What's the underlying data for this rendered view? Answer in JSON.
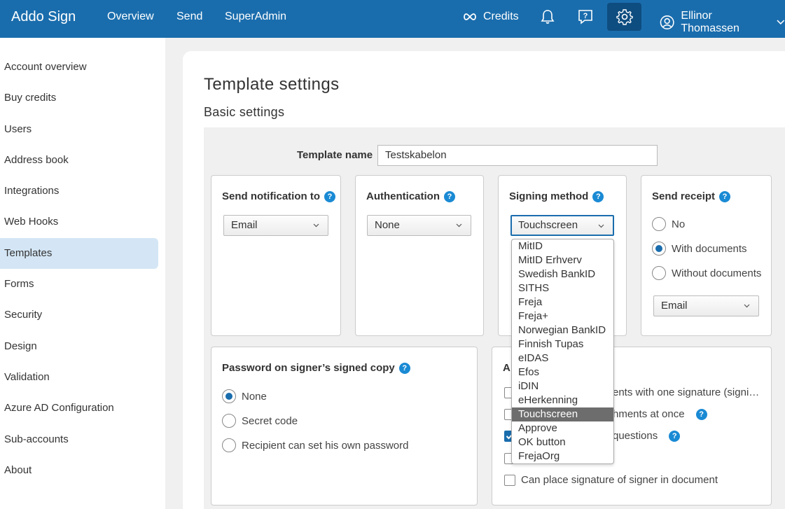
{
  "topbar": {
    "logo": "Addo Sign",
    "nav": [
      "Overview",
      "Send",
      "SuperAdmin"
    ],
    "credits": "Credits",
    "user": "Ellinor Thomassen",
    "icons": [
      "infinity-icon",
      "bell-icon",
      "help-chat-icon",
      "gear-icon",
      "user-icon",
      "chevron-down-icon"
    ]
  },
  "sidebar": {
    "items": [
      {
        "label": "Account overview"
      },
      {
        "label": "Buy credits"
      },
      {
        "label": "Users"
      },
      {
        "label": "Address book"
      },
      {
        "label": "Integrations"
      },
      {
        "label": "Web Hooks"
      },
      {
        "label": "Templates",
        "active": true
      },
      {
        "label": "Forms"
      },
      {
        "label": "Security"
      },
      {
        "label": "Design"
      },
      {
        "label": "Validation"
      },
      {
        "label": "Azure AD Configuration"
      },
      {
        "label": "Sub-accounts"
      },
      {
        "label": "About"
      }
    ]
  },
  "page": {
    "title": "Template settings",
    "section": "Basic settings",
    "template_name_label": "Template name",
    "template_name_value": "Testskabelon"
  },
  "notification": {
    "title": "Send notification to",
    "value": "Email"
  },
  "authentication": {
    "title": "Authentication",
    "value": "None"
  },
  "signing": {
    "title": "Signing method",
    "value": "Touchscreen",
    "options": [
      "MitID",
      "MitID Erhverv",
      "Swedish BankID",
      "SITHS",
      "Freja",
      "Freja+",
      "Norwegian BankID",
      "Finnish Tupas",
      "eIDAS",
      "Efos",
      "iDIN",
      "eHerkenning",
      "Touchscreen",
      "Approve",
      "OK button",
      "FrejaOrg"
    ],
    "selected": "Touchscreen"
  },
  "receipt": {
    "title": "Send receipt",
    "options": [
      "No",
      "With documents",
      "Without documents"
    ],
    "selected": "With documents",
    "format_value": "Email"
  },
  "password": {
    "title": "Password on signer’s signed copy",
    "options": [
      "None",
      "Secret code",
      "Recipient can set his own password"
    ],
    "selected": "None"
  },
  "advanced": {
    "title_partial": "A",
    "rows": [
      {
        "text": "ents with one signature (signi…",
        "checked": false
      },
      {
        "text": "hments at once",
        "checked": false
      },
      {
        "text": "questions",
        "checked": true
      },
      {
        "text": "",
        "checked": false
      },
      {
        "text": "Can place signature of signer in document",
        "checked": false
      }
    ]
  },
  "colors": {
    "brand": "#1a6dad",
    "help": "#1a8ad4",
    "active_nav": "#d4e6f5"
  }
}
